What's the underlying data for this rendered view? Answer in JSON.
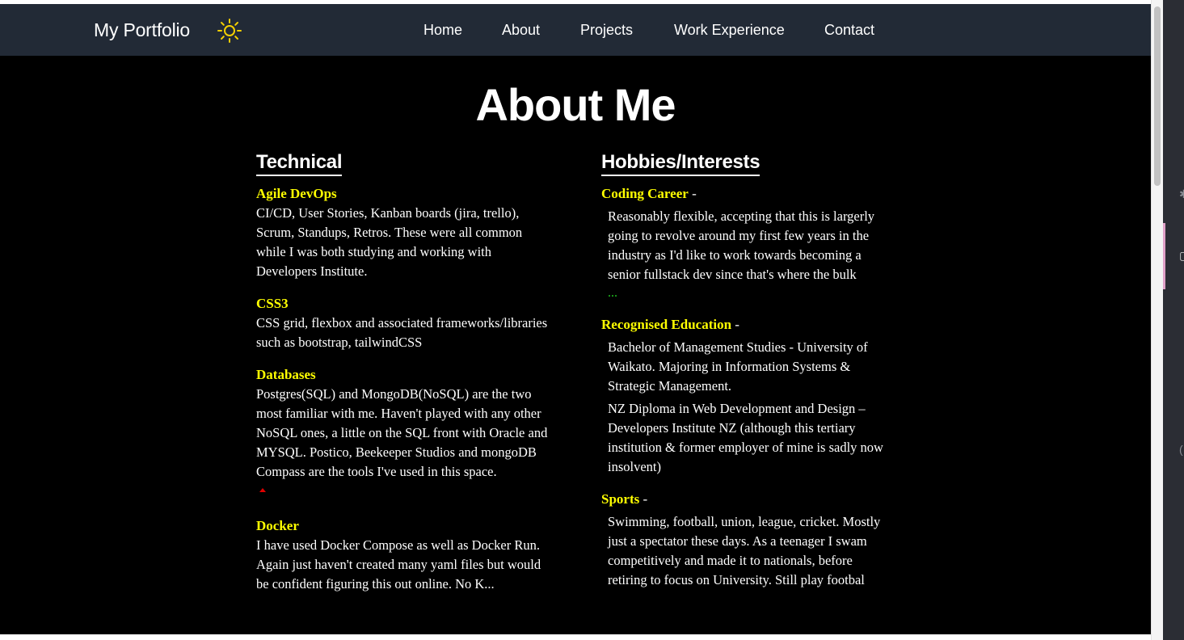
{
  "navbar": {
    "brand": "My Portfolio",
    "theme_icon": "sun-icon",
    "links": [
      "Home",
      "About",
      "Projects",
      "Work Experience",
      "Contact"
    ]
  },
  "page_title": "About Me",
  "technical": {
    "heading": "Technical",
    "skills": [
      {
        "title": "Agile DevOps",
        "text": "CI/CD, User Stories, Kanban boards (jira, trello), Scrum, Standups, Retros. These were all common while I was both studying and working with Developers Institute."
      },
      {
        "title": "CSS3",
        "text": "CSS grid, flexbox and associated frameworks/libraries such as bootstrap, tailwindCSS"
      },
      {
        "title": "Databases",
        "text": "Postgres(SQL) and MongoDB(NoSQL) are the two most familiar with me. Haven't played with any other NoSQL ones, a little on the SQL front with Oracle and MYSQL. Postico, Beekeeper Studios and mongoDB Compass are the tools I've used in this space."
      },
      {
        "title": "Docker",
        "text": "I have used Docker Compose as well as Docker Run. Again just haven't created many yaml files but would be confident figuring this out online. No K..."
      }
    ]
  },
  "hobbies": {
    "heading": "Hobbies/Interests",
    "items": [
      {
        "title": "Coding Career",
        "sep": " -",
        "paragraphs": [
          "Reasonably flexible, accepting that this is largerly going to revolve around my first few years in the industry as I'd like to work towards becoming a senior fullstack dev since that's where the bulk"
        ],
        "more": "..."
      },
      {
        "title": "Recognised Education",
        "sep": " -",
        "paragraphs": [
          "Bachelor of Management Studies - University of Waikato. Majoring in Information Systems & Strategic Management.",
          "NZ Diploma in Web Development and Design – Developers Institute NZ (although this tertiary institution & former employer of mine is sadly now insolvent)"
        ]
      },
      {
        "title": "Sports",
        "sep": " -",
        "paragraphs": [
          "Swimming, football, union, league, cricket. Mostly just a spectator these days. As a teenager I swam competitively and made it to nationals, before retiring to focus on University. Still play footbal"
        ]
      }
    ]
  }
}
